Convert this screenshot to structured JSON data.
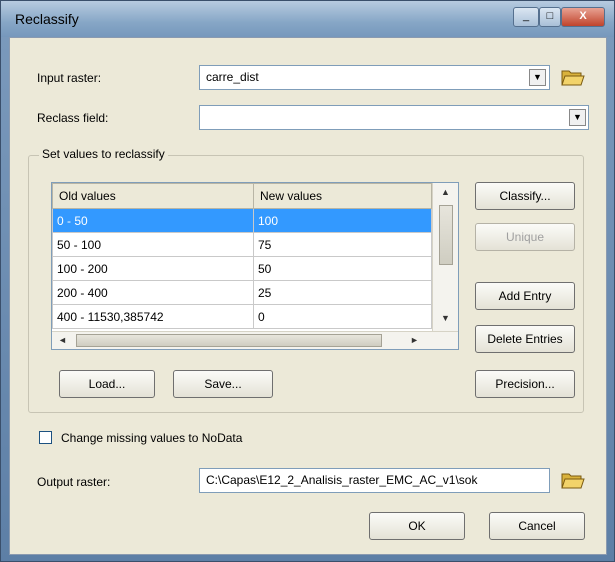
{
  "window": {
    "title": "Reclassify",
    "controls": [
      "_",
      "□",
      "X"
    ]
  },
  "input_raster": {
    "label": "Input raster:",
    "value": "carre_dist"
  },
  "reclass_field": {
    "label": "Reclass field:",
    "value": ""
  },
  "group": {
    "title": "Set values to reclassify"
  },
  "table": {
    "headers": [
      "Old values",
      "New values"
    ],
    "rows": [
      {
        "old": "0 - 50",
        "new": "100",
        "selected": true
      },
      {
        "old": "50 - 100",
        "new": "75",
        "selected": false
      },
      {
        "old": "100 - 200",
        "new": "50",
        "selected": false
      },
      {
        "old": "200 - 400",
        "new": "25",
        "selected": false
      },
      {
        "old": "400 - 11530,385742",
        "new": "0",
        "selected": false
      }
    ]
  },
  "side_buttons": {
    "classify": "Classify...",
    "unique": "Unique",
    "add_entry": "Add Entry",
    "delete_entries": "Delete Entries"
  },
  "bottom_buttons": {
    "load": "Load...",
    "save": "Save...",
    "precision": "Precision..."
  },
  "nodata": {
    "label": "Change missing values to NoData",
    "checked": false
  },
  "output_raster": {
    "label": "Output raster:",
    "value": "C:\\Capas\\E12_2_Analisis_raster_EMC_AC_v1\\sok"
  },
  "dialog_buttons": {
    "ok": "OK",
    "cancel": "Cancel"
  },
  "colors": {
    "selection": "#3399ff",
    "dialog_bg": "#ece9d8",
    "title_bar": "#86a6c6",
    "close_button": "#c0432b"
  },
  "icons": {
    "folder": "folder-open-icon",
    "dropdown": "chevron-down-icon"
  }
}
